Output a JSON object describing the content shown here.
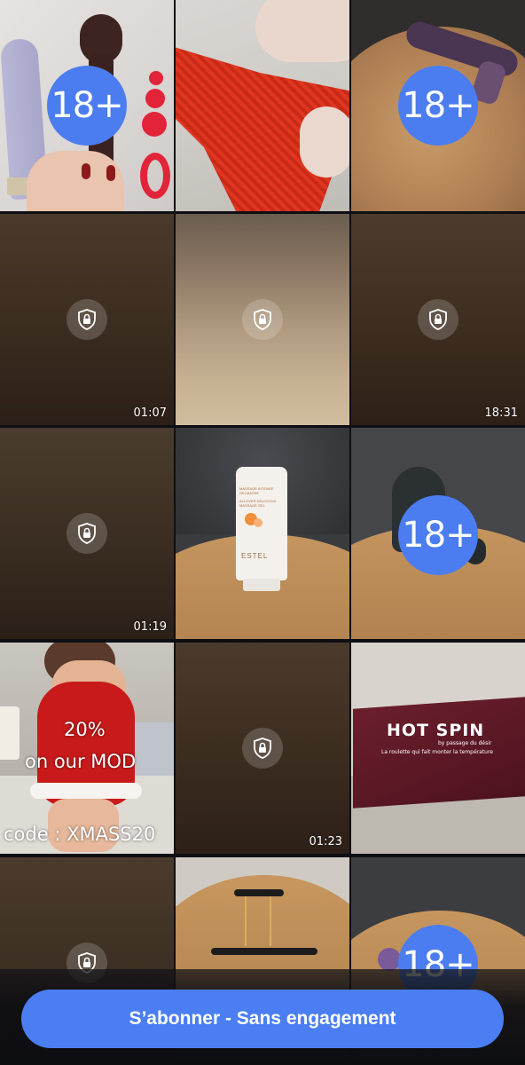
{
  "grid": {
    "tiles": [
      {
        "kind": "photo",
        "badge": "18+",
        "icon": "adult-content-badge"
      },
      {
        "kind": "photo",
        "badge": ""
      },
      {
        "kind": "photo",
        "badge": "18+",
        "icon": "adult-content-badge"
      },
      {
        "kind": "locked-video",
        "duration": "01:07",
        "icon": "lock-shield-icon"
      },
      {
        "kind": "locked-photo",
        "icon": "lock-shield-icon"
      },
      {
        "kind": "locked-video",
        "duration": "18:31",
        "icon": "lock-shield-icon"
      },
      {
        "kind": "locked-video",
        "duration": "01:19",
        "icon": "lock-shield-icon"
      },
      {
        "kind": "photo",
        "product_text": "MASSAGE INTENSE GELMASSE",
        "product_name": "ALLOVER DELICIOUS MASSAGE GEL",
        "brand": "ESTEL"
      },
      {
        "kind": "photo",
        "badge": "18+",
        "icon": "adult-content-badge"
      },
      {
        "kind": "photo",
        "promo_line1": "20%",
        "promo_line2": "on our MOD",
        "promo_code": "code : XMASS20"
      },
      {
        "kind": "locked-video",
        "duration": "01:23",
        "icon": "lock-shield-icon"
      },
      {
        "kind": "photo",
        "box_title": "HOT SPIN",
        "box_sub": "by passage du désir",
        "box_tagline": "La roulette qui fait monter la température"
      },
      {
        "kind": "locked-video",
        "icon": "lock-shield-icon"
      },
      {
        "kind": "photo"
      },
      {
        "kind": "photo",
        "badge": "18+",
        "icon": "adult-content-badge"
      }
    ]
  },
  "subscribe": {
    "label": "S’abonner - Sans engagement"
  },
  "colors": {
    "accent": "#4a7ef2",
    "badge": "#4b7df0",
    "background": "#0e0f14"
  }
}
